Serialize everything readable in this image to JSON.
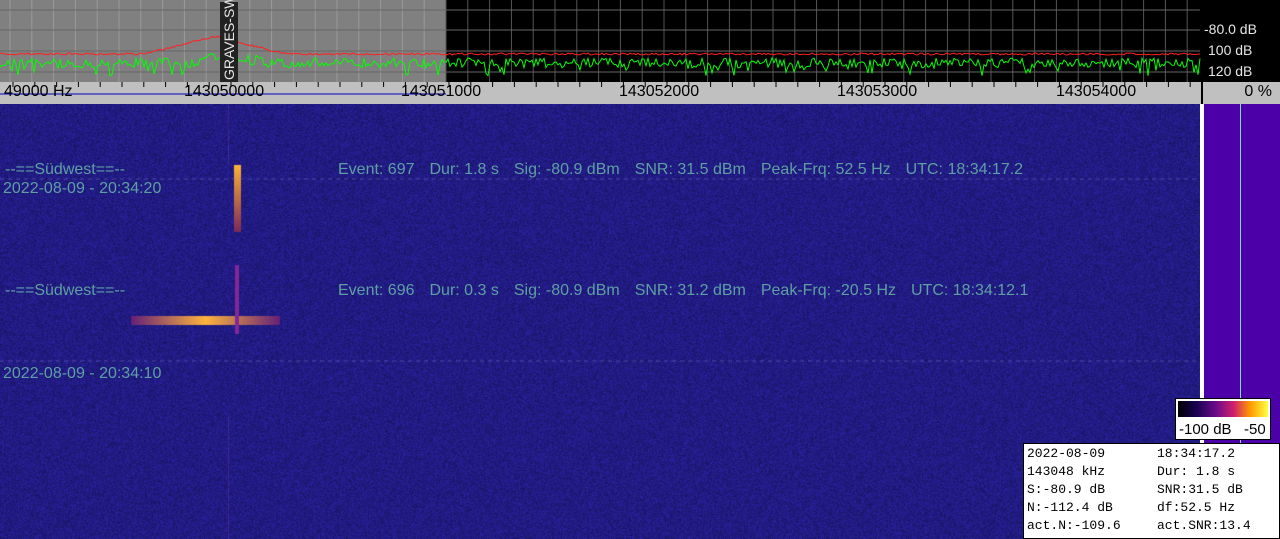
{
  "spectrum": {
    "db_labels": [
      "-80.0 dB",
      "100 dB",
      "120 dB"
    ],
    "station_label": "GRAVES-SW",
    "colors": {
      "noise_trace": "#00ff00",
      "avg_trace": "#ff2020",
      "grid": "#606060",
      "selection": "#808080"
    }
  },
  "freq_axis": {
    "labels": [
      "49000 Hz",
      "143050000",
      "143051000",
      "143052000",
      "143053000",
      "143054000"
    ]
  },
  "level_percent": "0 %",
  "waterfall": {
    "events": [
      {
        "station": "--==Südwest==--",
        "event": "Event: 697",
        "dur": "Dur: 1.8 s",
        "sig": "Sig: -80.9 dBm",
        "snr": "SNR: 31.5 dBm",
        "peak": "Peak-Frq: 52.5 Hz",
        "utc": "UTC: 18:34:17.2"
      },
      {
        "station": "--==Südwest==--",
        "event": "Event: 696",
        "dur": "Dur: 0.3 s",
        "sig": "Sig: -80.9 dBm",
        "snr": "SNR: 31.2 dBm",
        "peak": "Peak-Frq: -20.5 Hz",
        "utc": "UTC: 18:34:12.1"
      }
    ],
    "timestamps": [
      "2022-08-09 - 20:34:20",
      "2022-08-09 - 20:34:10"
    ],
    "colors": {
      "background": "#1c1a7a",
      "text": "#5f9fa4"
    }
  },
  "legend": {
    "min_label": "-100 dB",
    "max_label": "-50"
  },
  "info": {
    "rows": [
      {
        "left": "2022-08-09",
        "right": "18:34:17.2"
      },
      {
        "left": "143048 kHz",
        "right": "Dur: 1.8 s"
      },
      {
        "left": "S:-80.9 dB",
        "right": "SNR:31.5 dB"
      },
      {
        "left": "N:-112.4 dB",
        "right": "df:52.5 Hz"
      },
      {
        "left": "act.N:-109.6",
        "right": "act.SNR:13.4"
      }
    ]
  }
}
